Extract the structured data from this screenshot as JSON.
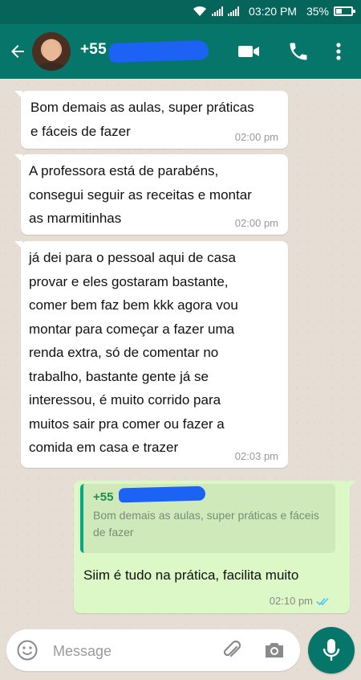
{
  "status_bar": {
    "time": "03:20 PM",
    "battery_percent": "35%",
    "battery_level": 0.35,
    "icons": [
      "wifi-icon",
      "signal-icon",
      "signal-icon",
      "battery-icon"
    ]
  },
  "header": {
    "contact_name": "+55",
    "icons": [
      "back-arrow-icon",
      "avatar",
      "video-call-icon",
      "phone-icon",
      "more-vertical-icon"
    ]
  },
  "messages": [
    {
      "text": " Bom demais as aulas, super práticas\ne fáceis de fazer",
      "time": "02:00 pm"
    },
    {
      "text": " A professora está de parabéns,\nconsegui seguir as receitas e montar\nas marmitinhas",
      "time": "02:00 pm"
    },
    {
      "text": " já dei para o pessoal aqui de casa\nprovar e eles gostaram bastante,\ncomer bem faz bem kkk agora vou\nmontar para começar a fazer uma\nrenda extra, só de comentar no\ntrabalho, bastante gente já se\ninteressou, é muito corrido para\nmuitos sair pra comer ou fazer a\ncomida em casa e trazer",
      "time": "02:03 pm"
    }
  ],
  "reply": {
    "quoted_name": "+55",
    "quoted_text": "Bom demais as aulas, super práticas e fáceis\nde fazer",
    "text": "Siim é tudo na prática, facilita muito",
    "time": "02:10 pm",
    "status_icon": "double-check-icon",
    "status_color": "#4fc3f7"
  },
  "composer": {
    "placeholder": "Message",
    "icons": [
      "emoji-icon",
      "attach-icon",
      "camera-icon",
      "mic-icon"
    ]
  },
  "colors": {
    "header": "#07766a",
    "status_bar": "#05655a",
    "outgoing_bubble": "#dcf8c6",
    "incoming_bubble": "#ffffff",
    "redaction": "#1b62f5"
  }
}
